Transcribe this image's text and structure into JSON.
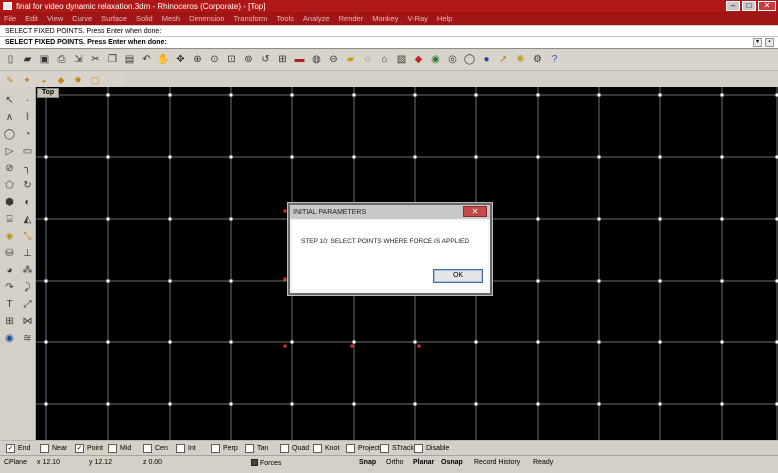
{
  "window": {
    "title": "final for video dynamic relaxation.3dm - Rhinoceros (Corporate) - [Top]",
    "minimize_glyph": "–",
    "maximize_glyph": "□",
    "close_glyph": "✕"
  },
  "menu": [
    "File",
    "Edit",
    "View",
    "Curve",
    "Surface",
    "Solid",
    "Mesh",
    "Dimension",
    "Transform",
    "Tools",
    "Analyze",
    "Render",
    "Monkey",
    "V-Ray",
    "Help"
  ],
  "command": {
    "history": "SELECT FIXED POINTS. Press Enter when done:",
    "prompt": "SELECT FIXED POINTS. Press Enter when done:"
  },
  "toolbar_icons": [
    "new-file-icon",
    "open-icon",
    "save-icon",
    "print-icon",
    "import-icon",
    "cut-icon",
    "copy-icon",
    "paste-icon",
    "undo-icon",
    "pan-icon",
    "rotate-view-icon",
    "zoom-dynamic-icon",
    "zoom-window-icon",
    "zoom-extents-icon",
    "zoom-selected-icon",
    "undo-view-icon",
    "viewport-layout-icon",
    "car-icon",
    "camera-icon",
    "dimension-icon",
    "layer-icon",
    "bulb-icon",
    "lock-icon",
    "properties-icon",
    "render-icon",
    "color-icon",
    "shade-icon",
    "ghost-icon",
    "material-icon",
    "osnap-icon",
    "sun-icon",
    "options-icon",
    "help-icon"
  ],
  "toolbar2_icons": [
    "vray-render-icon",
    "vray-options-icon",
    "vray-material-icon",
    "vray-light-icon",
    "vray-sun-icon",
    "vray-frame-icon"
  ],
  "left_toolbar_icons": [
    "select-icon",
    "point-icon",
    "curve-icon",
    "control-curve-icon",
    "circle-icon",
    "arc-icon",
    "polyline-icon",
    "rectangle-icon",
    "ellipse-icon",
    "fillet-icon",
    "surface-icon",
    "revolve-icon",
    "box-icon",
    "sphere-icon",
    "cylinder-icon",
    "extrude-icon",
    "boolean-icon",
    "edit-icon",
    "mesh-icon",
    "flow-icon",
    "group-icon",
    "array-icon",
    "mirror-icon",
    "trim-icon",
    "text-icon",
    "dimension-icon",
    "block-icon",
    "analyze-icon",
    "render-icon",
    "more-icon"
  ],
  "viewport": {
    "label": "Top"
  },
  "dialog": {
    "title": "INITIAL PARAMETERS",
    "close_glyph": "✕",
    "message": "STEP 10: SELECT POINTS WHERE FORCE IS APPLIED",
    "ok_label": "OK"
  },
  "osnaps": [
    {
      "label": "End",
      "checked": true
    },
    {
      "label": "Near",
      "checked": false
    },
    {
      "label": "Point",
      "checked": true
    },
    {
      "label": "Mid",
      "checked": false
    },
    {
      "label": "Cen",
      "checked": false
    },
    {
      "label": "Int",
      "checked": false
    },
    {
      "label": "Perp",
      "checked": false
    },
    {
      "label": "Tan",
      "checked": false
    },
    {
      "label": "Quad",
      "checked": false
    },
    {
      "label": "Knot",
      "checked": false
    },
    {
      "label": "Project",
      "checked": false
    },
    {
      "label": "STrack",
      "checked": false
    },
    {
      "label": "Disable",
      "checked": false
    }
  ],
  "status": {
    "cplane": "CPlane",
    "x": "x 12.10",
    "y": "y 12.12",
    "z": "z 0.00",
    "layer": "Forces",
    "snap": "Snap",
    "ortho": "Ortho",
    "planar": "Planar",
    "osnap": "Osnap",
    "record_history": "Record History",
    "ready": "Ready"
  },
  "colors": {
    "title_bar": "#b01818",
    "viewport_bg": "#000000",
    "grid_line": "#6e6e6e",
    "selected_point": "#e03030"
  }
}
